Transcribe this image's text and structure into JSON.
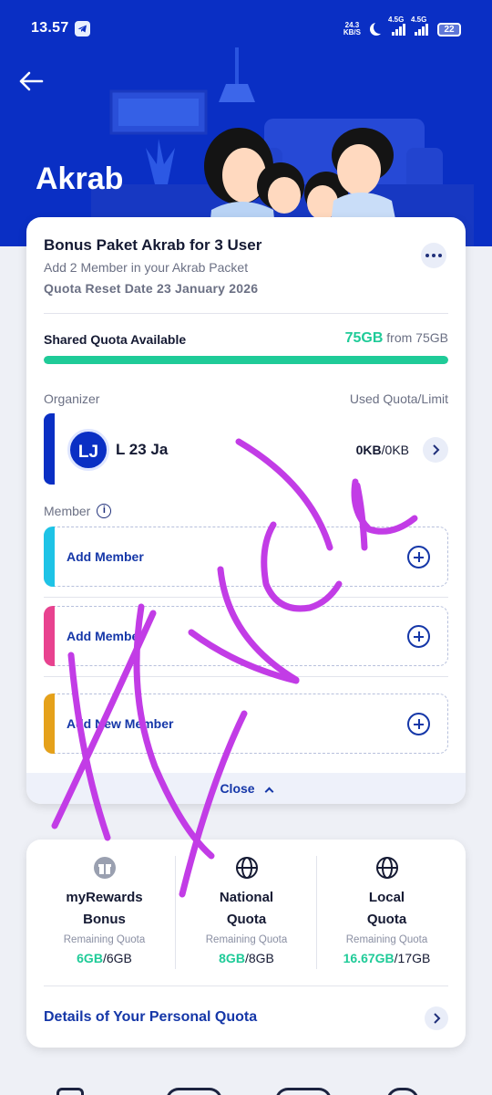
{
  "status_bar": {
    "time": "13.57",
    "net_speed_value": "24.3",
    "net_speed_unit": "KB/S",
    "network1": "4.5G",
    "network2": "4.5G",
    "battery": "22"
  },
  "header": {
    "title": "Akrab"
  },
  "package": {
    "title": "Bonus Paket Akrab for 3 User",
    "subtitle": "Add 2 Member in your Akrab Packet",
    "reset": "Quota Reset Date 23 January 2026",
    "shared_label": "Shared Quota Available",
    "shared_available": "75GB",
    "shared_from": "from 75GB",
    "shared_fraction": 1.0
  },
  "organizer": {
    "label": "Organizer",
    "used_label": "Used Quota/Limit",
    "initials": "LJ",
    "name": "L 23 Ja",
    "used": "0KB",
    "limit": "/0KB"
  },
  "members": {
    "label": "Member",
    "items": [
      {
        "text": "Add Member",
        "accent": "#1ec3e6"
      },
      {
        "text": "Add Member",
        "accent": "#e8428f"
      },
      {
        "text": "Add New Member",
        "accent": "#e5a11a"
      }
    ]
  },
  "close_label": "Close",
  "personal_quota": {
    "columns": [
      {
        "name1": "myRewards",
        "name2": "Bonus",
        "icon": "gift-icon",
        "remaining_label": "Remaining Quota",
        "value": "6GB",
        "total": "/6GB"
      },
      {
        "name1": "National",
        "name2": "Quota",
        "icon": "globe-icon",
        "remaining_label": "Remaining Quota",
        "value": "8GB",
        "total": "/8GB"
      },
      {
        "name1": "Local",
        "name2": "Quota",
        "icon": "globe-icon",
        "remaining_label": "Remaining Quota",
        "value": "16.67GB",
        "total": "/17GB"
      }
    ],
    "details_label": "Details of Your Personal Quota"
  },
  "colors": {
    "brand_blue": "#0a2fc4",
    "accent_green": "#1fcb98",
    "link_blue": "#1537a8",
    "scribble": "#c23ce6"
  }
}
